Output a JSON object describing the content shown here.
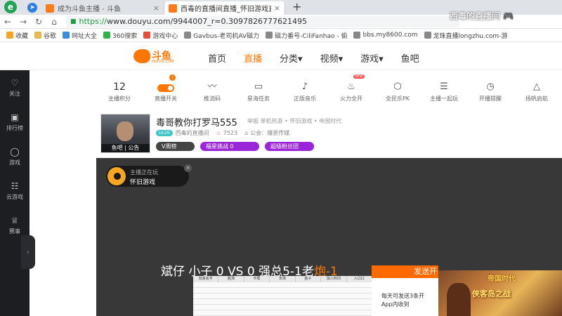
{
  "browser": {
    "tabs": [
      {
        "title": "成为斗鱼主播 - 斗鱼",
        "active": false
      },
      {
        "title": "西毒的直播间直播_怀旧游戏直",
        "active": true
      }
    ],
    "new_tab": "+",
    "address": {
      "scheme": "https://",
      "rest": "www.douyu.com/9944007_r=0.3097826777621495"
    },
    "bookmarks": [
      {
        "label": "收藏",
        "icon": "star-icon",
        "color": "#f5a623"
      },
      {
        "label": "谷歌",
        "icon": "folder-icon",
        "color": "#e7b949"
      },
      {
        "label": "网址大全",
        "icon": "globe-icon",
        "color": "#3c8de0"
      },
      {
        "label": "360搜索",
        "icon": "search-icon",
        "color": "#2fb34a"
      },
      {
        "label": "游戏中心",
        "icon": "gamepad-icon",
        "color": "#e74c3c"
      },
      {
        "label": "Gavbus-老司机AV磁力",
        "icon": "page-icon",
        "color": "#888888"
      },
      {
        "label": "磁力番号-CiliFanhao - 偷",
        "icon": "page-icon",
        "color": "#888888"
      },
      {
        "label": "bbs.my8600.com",
        "icon": "page-icon",
        "color": "#888888"
      },
      {
        "label": "龙珠直播longzhu.com-游",
        "icon": "page-icon",
        "color": "#888888"
      }
    ]
  },
  "site": {
    "logo_text": "斗鱼",
    "logo_sub": "DOUYU.COM",
    "nav": [
      {
        "label": "首页",
        "active": false
      },
      {
        "label": "直播",
        "active": true
      },
      {
        "label": "分类▾",
        "active": false
      },
      {
        "label": "视频▾",
        "active": false
      },
      {
        "label": "游戏▾",
        "active": false
      },
      {
        "label": "鱼吧",
        "active": false
      }
    ]
  },
  "sidebar": {
    "items": [
      {
        "label": "关注",
        "icon": "heart-icon",
        "glyph": "♡"
      },
      {
        "label": "排行榜",
        "icon": "ranking-icon",
        "glyph": "▣"
      },
      {
        "label": "游戏",
        "icon": "game-icon",
        "glyph": "◯"
      },
      {
        "label": "云游戏",
        "icon": "cloud-game-icon",
        "glyph": "☷"
      },
      {
        "label": "赛事",
        "icon": "trophy-icon",
        "glyph": "♕"
      }
    ],
    "toggle": "›"
  },
  "toolbar": {
    "points": {
      "value": "12",
      "label": "主播积分"
    },
    "items": [
      {
        "label": "直播开关",
        "icon": "switch-icon",
        "badge": "!"
      },
      {
        "label": "推流码",
        "icon": "waveform-icon",
        "glyph": "〰"
      },
      {
        "label": "星海任务",
        "icon": "ad-icon",
        "glyph": "▭"
      },
      {
        "label": "正版音乐",
        "icon": "music-icon",
        "glyph": "♪"
      },
      {
        "label": "火力全开",
        "icon": "fire-icon",
        "glyph": "♨",
        "badge": "NEW"
      },
      {
        "label": "全民乐PK",
        "icon": "pk-icon",
        "glyph": "⬡"
      },
      {
        "label": "主播一起玩",
        "icon": "play-together-icon",
        "glyph": "☰"
      },
      {
        "label": "开播提醒",
        "icon": "alarm-icon",
        "glyph": "◷"
      },
      {
        "label": "扬帆启航",
        "icon": "sail-icon",
        "glyph": "△"
      }
    ]
  },
  "room": {
    "avatar_caption": "鱼吧 | 公告",
    "title": "毒哥教你打罗马555",
    "links": "举报   单机热游 • 怀旧游戏 • 帝国时代",
    "level": "LV.26",
    "owner": "西毒的直播间",
    "hot": "7523",
    "notice": "公会：爆景传媒",
    "buttons": {
      "rank": "V周榜",
      "challenge": "福星挑战  0",
      "fans": "超级粉丝团"
    }
  },
  "video": {
    "now_playing_label": "主播正在玩",
    "now_playing_game": "怀旧游戏",
    "close": "×",
    "score_text": "斌仔 小子  0   VS 0   强总5-1老",
    "score_tail": "炮-1",
    "sheet_headers": [
      "玩家名字",
      "胜场",
      "平局",
      "负场",
      "金子",
      "加入时间",
      "入口口"
    ],
    "gift_top": "发送开",
    "gift_text": "每天可发送3条开\nApp内收到",
    "ad_brand": "帝国时代",
    "ad_slogan": "侠客岛之战",
    "watermark": "西毒的直播间 🎮"
  }
}
